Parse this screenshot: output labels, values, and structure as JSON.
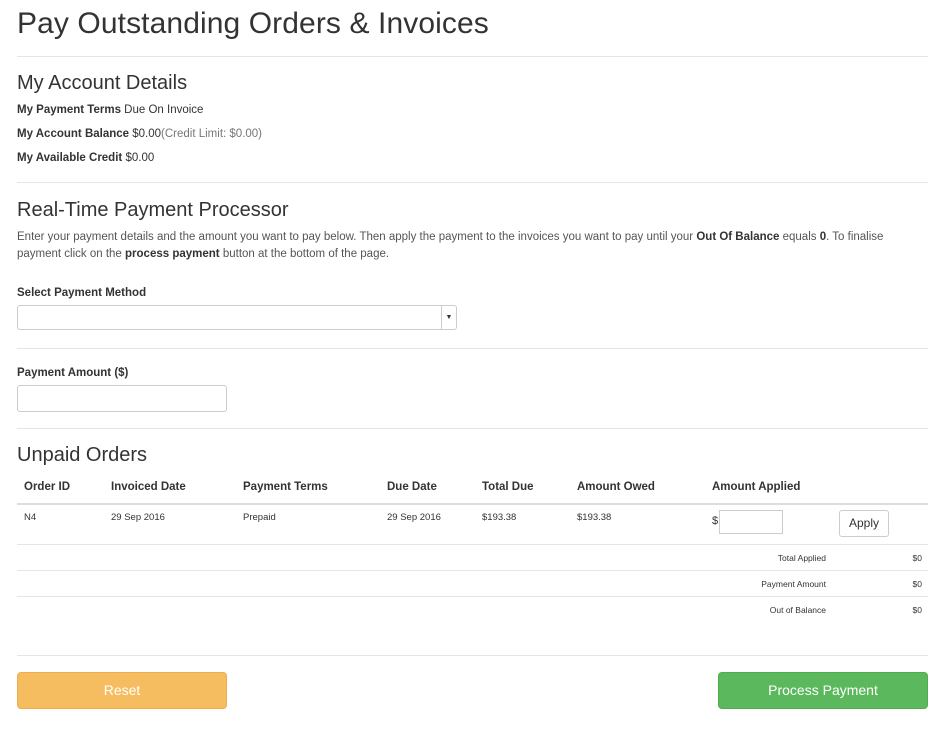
{
  "page": {
    "title": "Pay Outstanding Orders & Invoices"
  },
  "account": {
    "heading": "My Account Details",
    "payment_terms_label": "My Payment Terms",
    "payment_terms_value": "Due On Invoice",
    "balance_label": "My Account Balance",
    "balance_value": "$0.00",
    "credit_limit": "(Credit Limit: $0.00)",
    "available_credit_label": "My Available Credit",
    "available_credit_value": "$0.00"
  },
  "processor": {
    "heading": "Real-Time Payment Processor",
    "intro_1": "Enter your payment details and the amount you want to pay below. Then apply the payment to the invoices you want to pay until your ",
    "intro_bold_1": "Out Of Balance",
    "intro_2": " equals ",
    "intro_bold_2": "0",
    "intro_3": ". To finalise payment click on the ",
    "intro_bold_3": "process payment",
    "intro_4": " button at the bottom of the page.",
    "payment_method_label": "Select Payment Method",
    "payment_method_value": "",
    "payment_amount_label": "Payment Amount ($)",
    "payment_amount_value": ""
  },
  "orders": {
    "heading": "Unpaid Orders",
    "columns": [
      "Order ID",
      "Invoiced Date",
      "Payment Terms",
      "Due Date",
      "Total Due",
      "Amount Owed",
      "Amount Applied"
    ],
    "rows": [
      {
        "order_id": "N4",
        "invoiced_date": "29 Sep 2016",
        "payment_terms": "Prepaid",
        "due_date": "29 Sep 2016",
        "total_due": "$193.38",
        "amount_owed": "$193.38",
        "currency_symbol": "$",
        "amount_applied": "",
        "apply_label": "Apply"
      }
    ],
    "summary": [
      {
        "label": "Total Applied",
        "value": "$0"
      },
      {
        "label": "Payment Amount",
        "value": "$0"
      },
      {
        "label": "Out of Balance",
        "value": "$0"
      }
    ]
  },
  "actions": {
    "reset_label": "Reset",
    "process_label": "Process Payment"
  },
  "colors": {
    "reset": "#f6bd60",
    "process": "#5cb85c"
  }
}
